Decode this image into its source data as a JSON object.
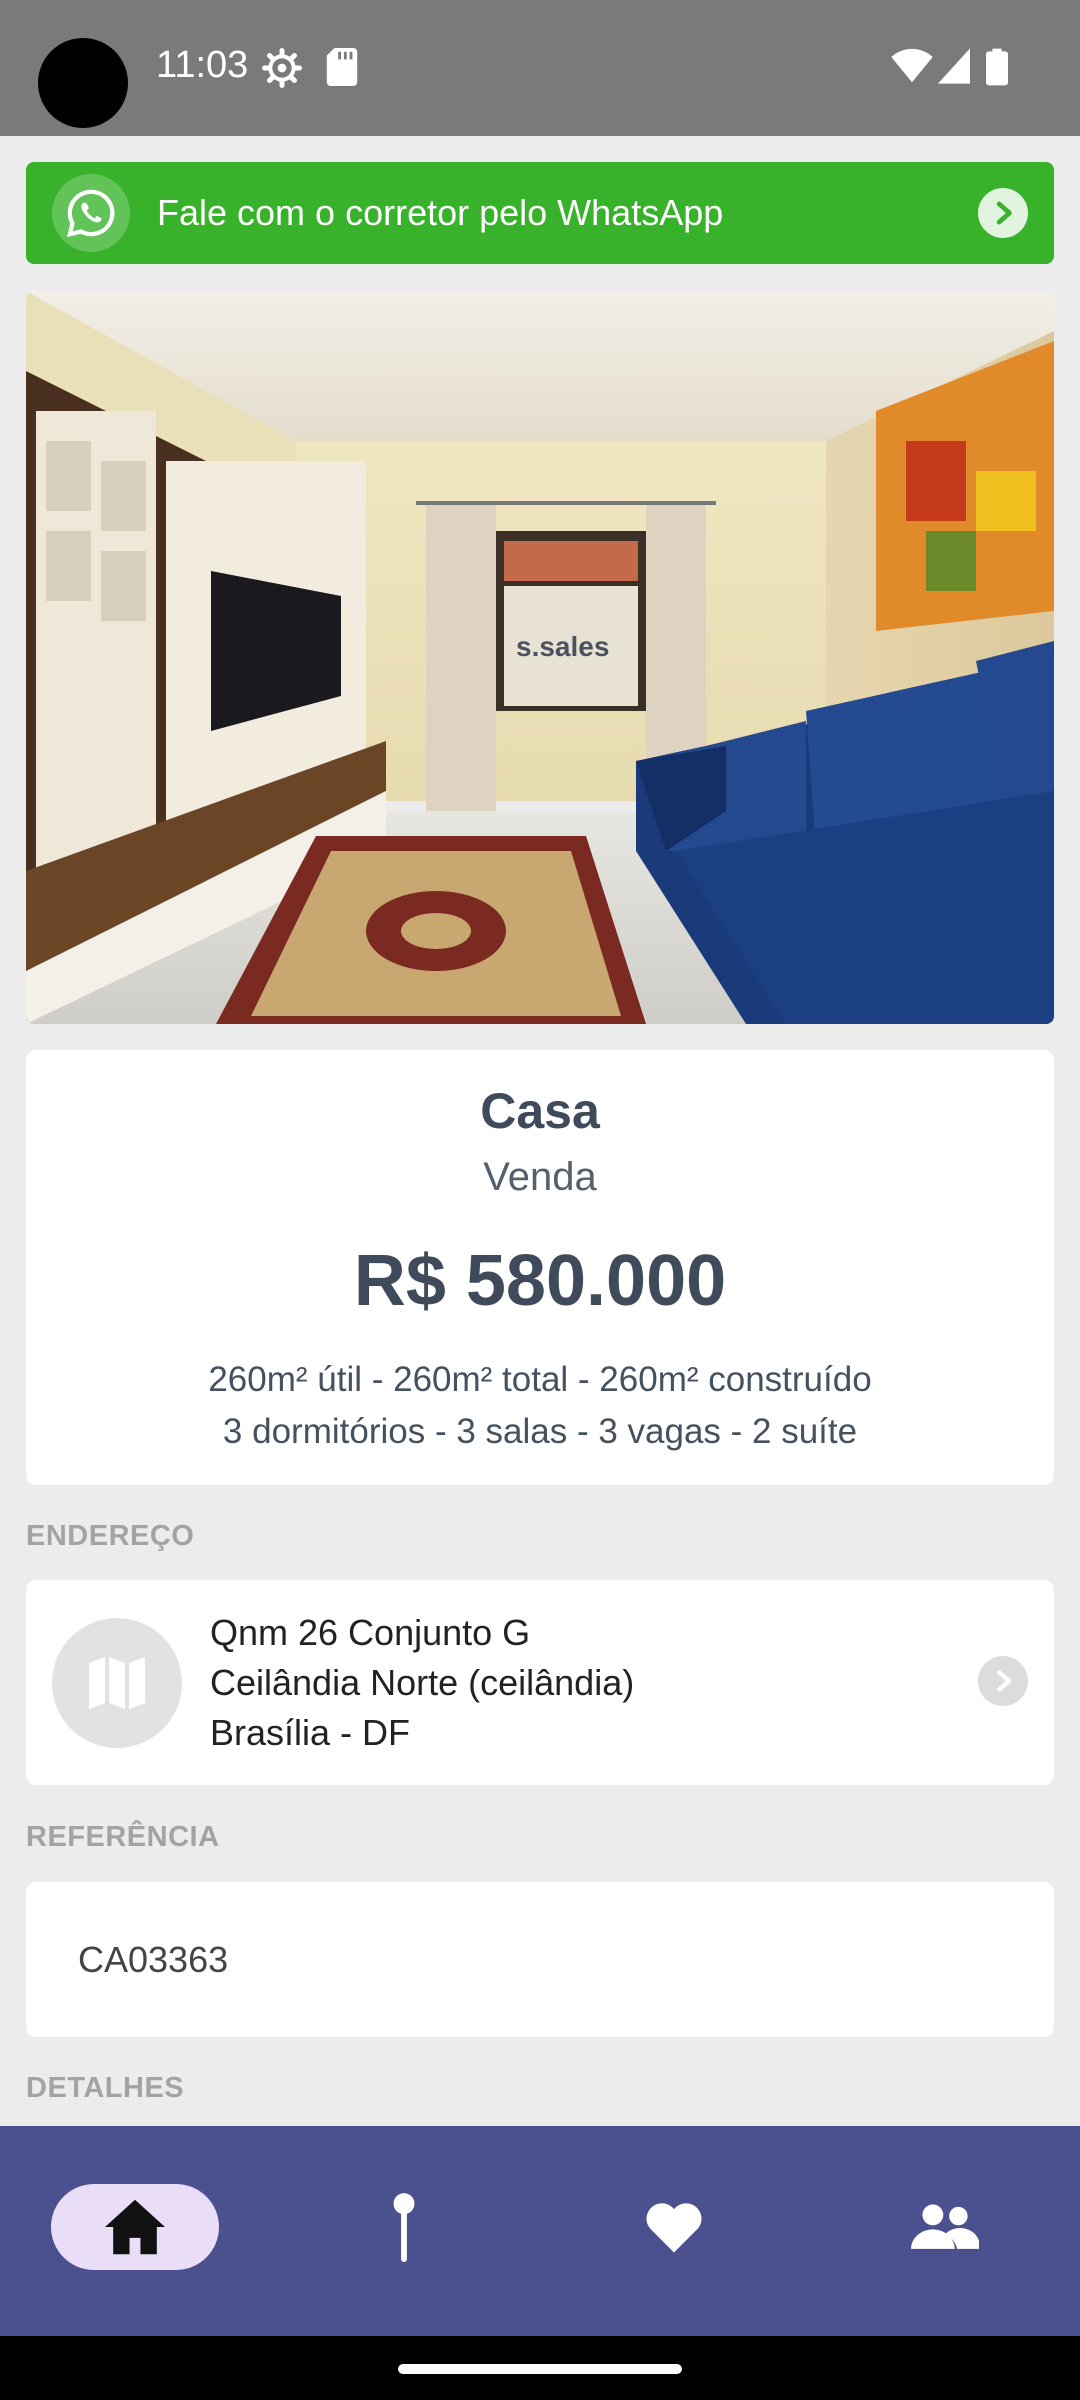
{
  "status_bar": {
    "time": "11:03",
    "icons": [
      "settings-icon",
      "sd-card-icon",
      "wifi-icon",
      "signal-icon",
      "battery-icon"
    ]
  },
  "whatsapp_banner": {
    "text": "Fale com o corretor pelo WhatsApp",
    "color": "#37b22a",
    "icon": "whatsapp-icon",
    "arrow_icon": "chevron-right-icon"
  },
  "photo": {
    "watermark": "s.sales",
    "description_icon": "property-photo"
  },
  "property": {
    "type": "Casa",
    "deal": "Venda",
    "price": "R$ 580.000",
    "areas": "260m² útil - 260m² total - 260m² construído",
    "rooms": "3 dormitórios - 3 salas - 3 vagas - 2 suíte"
  },
  "address": {
    "label": "ENDEREÇO",
    "line1": "Qnm 26 Conjunto G",
    "line2": "Ceilândia Norte (ceilândia)",
    "line3": "Brasília - DF",
    "icon": "map-icon",
    "arrow_icon": "chevron-right-icon"
  },
  "reference": {
    "label": "REFERÊNCIA",
    "code": "CA03363"
  },
  "details": {
    "label": "DETALHES"
  },
  "bottom_nav": {
    "color": "#4b518e",
    "items": [
      {
        "icon": "home-icon",
        "active": true
      },
      {
        "icon": "location-pin-icon",
        "active": false
      },
      {
        "icon": "heart-icon",
        "active": false
      },
      {
        "icon": "people-icon",
        "active": false
      }
    ]
  }
}
